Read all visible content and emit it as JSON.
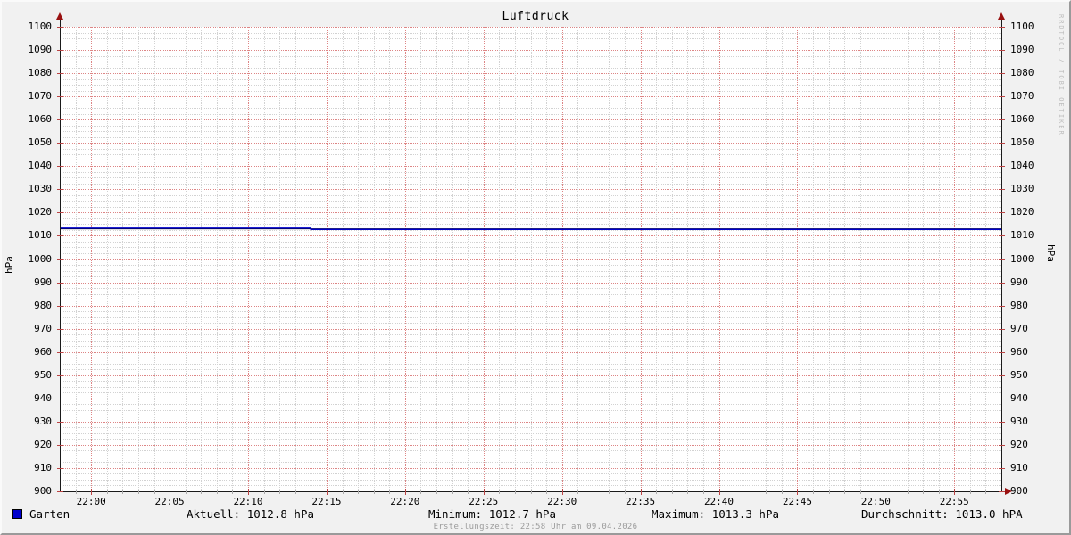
{
  "title": "Luftdruck",
  "watermark": "RRDTOOL / TOBI OETIKER",
  "footer": {
    "text": "Erstellungszeit: 22:58 Uhr am 09.04.2026"
  },
  "axis": {
    "left_label": "hPa",
    "right_label": "hPa"
  },
  "legend": {
    "series": {
      "label": "Garten",
      "color": "#0000cc"
    },
    "stats": [
      {
        "label": "Aktuell",
        "text": "Aktuell: 1012.8 hPa"
      },
      {
        "label": "Minimum",
        "text": "Minimum: 1012.7 hPa"
      },
      {
        "label": "Maximum",
        "text": "Maximum: 1013.3 hPa"
      },
      {
        "label": "Durchschnitt",
        "text": "Durchschnitt: 1013.0 hPA"
      }
    ]
  },
  "chart_data": {
    "type": "line",
    "title": "Luftdruck",
    "ylabel": "hPa",
    "ylabel_right": "hPa",
    "ylim": [
      900,
      1100
    ],
    "ytick_step": 10,
    "yminor_step": 2.5,
    "x_start": "21:58",
    "x_end": "22:58",
    "xticks": [
      "22:00",
      "22:05",
      "22:10",
      "22:15",
      "22:20",
      "22:25",
      "22:30",
      "22:35",
      "22:40",
      "22:45",
      "22:50",
      "22:55"
    ],
    "xminor_step_min": 1,
    "grid": {
      "major_color": "#dd8585",
      "minor_color": "#d2d2d2",
      "grid_on": true
    },
    "axis_color": "#1a1a1a",
    "arrow_color": "#991111",
    "series": [
      {
        "name": "Garten",
        "color": "#0000cc",
        "points": [
          {
            "t": "21:58",
            "v": 1013.3
          },
          {
            "t": "22:14",
            "v": 1013.3
          },
          {
            "t": "22:14",
            "v": 1012.8
          },
          {
            "t": "22:58",
            "v": 1012.8
          }
        ]
      }
    ],
    "hrule": {
      "name": "Durchschnitt",
      "value": 1013.0,
      "color": "#000000"
    },
    "stats": {
      "aktuell_hpa": 1012.8,
      "minimum_hpa": 1012.7,
      "maximum_hpa": 1013.3,
      "durchschnitt_hpa": 1013.0
    }
  }
}
